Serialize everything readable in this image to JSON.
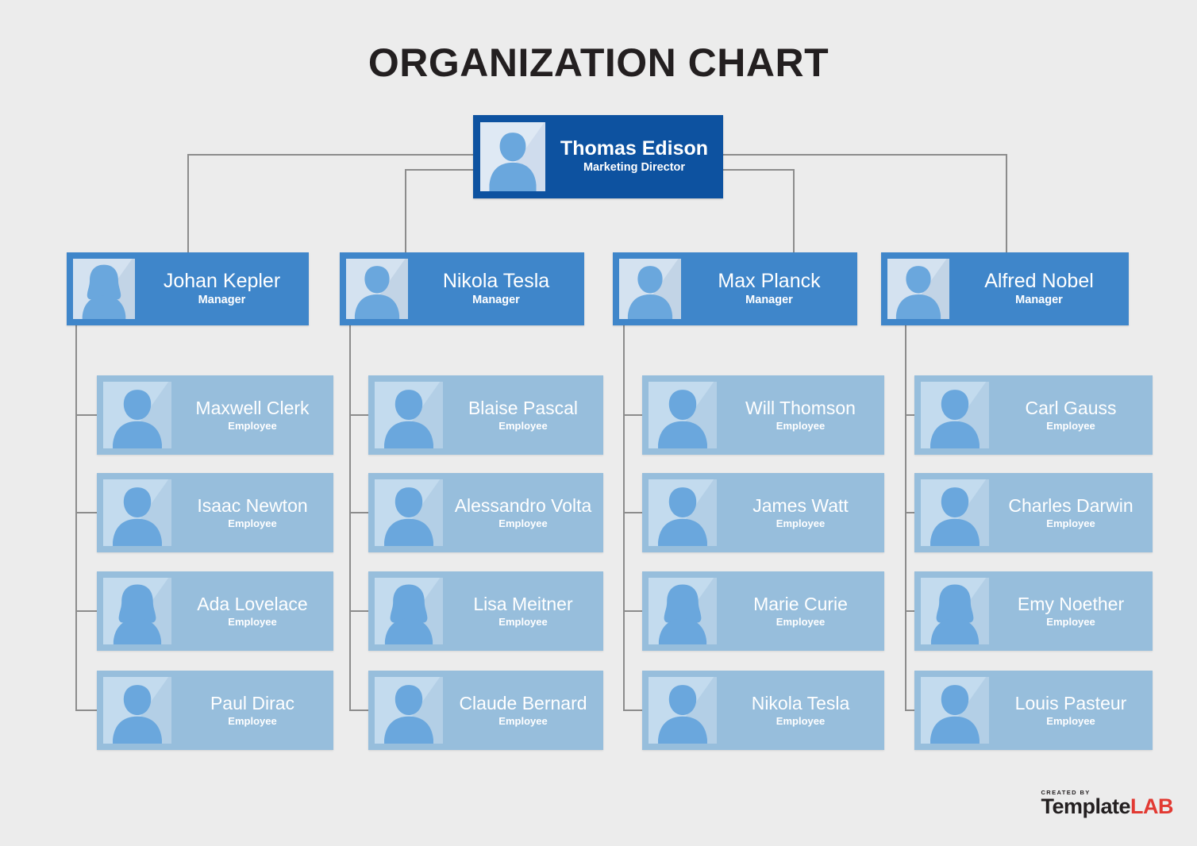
{
  "title": "ORGANIZATION CHART",
  "colors": {
    "background": "#ececec",
    "root_card": "#0d52a0",
    "manager_card": "#3f86ca",
    "employee_card": "#97bedc",
    "connector": "#8c8c8c",
    "title_text": "#231f20",
    "logo_accent": "#e23a33"
  },
  "root": {
    "name": "Thomas Edison",
    "role": "Marketing Director",
    "avatar": "male-avatar-icon"
  },
  "managers": [
    {
      "name": "Johan Kepler",
      "role": "Manager",
      "avatar": "female-avatar-icon"
    },
    {
      "name": "Nikola Tesla",
      "role": "Manager",
      "avatar": "male-avatar-icon"
    },
    {
      "name": "Max Planck",
      "role": "Manager",
      "avatar": "male-avatar-icon"
    },
    {
      "name": "Alfred Nobel",
      "role": "Manager",
      "avatar": "male-avatar-icon"
    }
  ],
  "columns": [
    {
      "manager": "Johan Kepler",
      "employees": [
        {
          "name": "Maxwell Clerk",
          "role": "Employee",
          "avatar": "male-avatar-icon"
        },
        {
          "name": "Isaac Newton",
          "role": "Employee",
          "avatar": "male-avatar-icon"
        },
        {
          "name": "Ada Lovelace",
          "role": "Employee",
          "avatar": "female-avatar-icon"
        },
        {
          "name": "Paul Dirac",
          "role": "Employee",
          "avatar": "male-avatar-icon"
        }
      ]
    },
    {
      "manager": "Nikola Tesla",
      "employees": [
        {
          "name": "Blaise Pascal",
          "role": "Employee",
          "avatar": "male-avatar-icon"
        },
        {
          "name": "Alessandro Volta",
          "role": "Employee",
          "avatar": "male-avatar-icon"
        },
        {
          "name": "Lisa Meitner",
          "role": "Employee",
          "avatar": "female-avatar-icon"
        },
        {
          "name": "Claude Bernard",
          "role": "Employee",
          "avatar": "male-avatar-icon"
        }
      ]
    },
    {
      "manager": "Max Planck",
      "employees": [
        {
          "name": "Will Thomson",
          "role": "Employee",
          "avatar": "male-avatar-icon"
        },
        {
          "name": "James Watt",
          "role": "Employee",
          "avatar": "male-avatar-icon"
        },
        {
          "name": "Marie Curie",
          "role": "Employee",
          "avatar": "female-avatar-icon"
        },
        {
          "name": "Nikola Tesla",
          "role": "Employee",
          "avatar": "male-avatar-icon"
        }
      ]
    },
    {
      "manager": "Alfred Nobel",
      "employees": [
        {
          "name": "Carl Gauss",
          "role": "Employee",
          "avatar": "male-avatar-icon"
        },
        {
          "name": "Charles Darwin",
          "role": "Employee",
          "avatar": "male-avatar-icon"
        },
        {
          "name": "Emy Noether",
          "role": "Employee",
          "avatar": "female-avatar-icon"
        },
        {
          "name": "Louis Pasteur",
          "role": "Employee",
          "avatar": "male-avatar-icon"
        }
      ]
    }
  ],
  "logo": {
    "created_by": "CREATED BY",
    "brand_primary": "Template",
    "brand_accent": "LAB"
  }
}
